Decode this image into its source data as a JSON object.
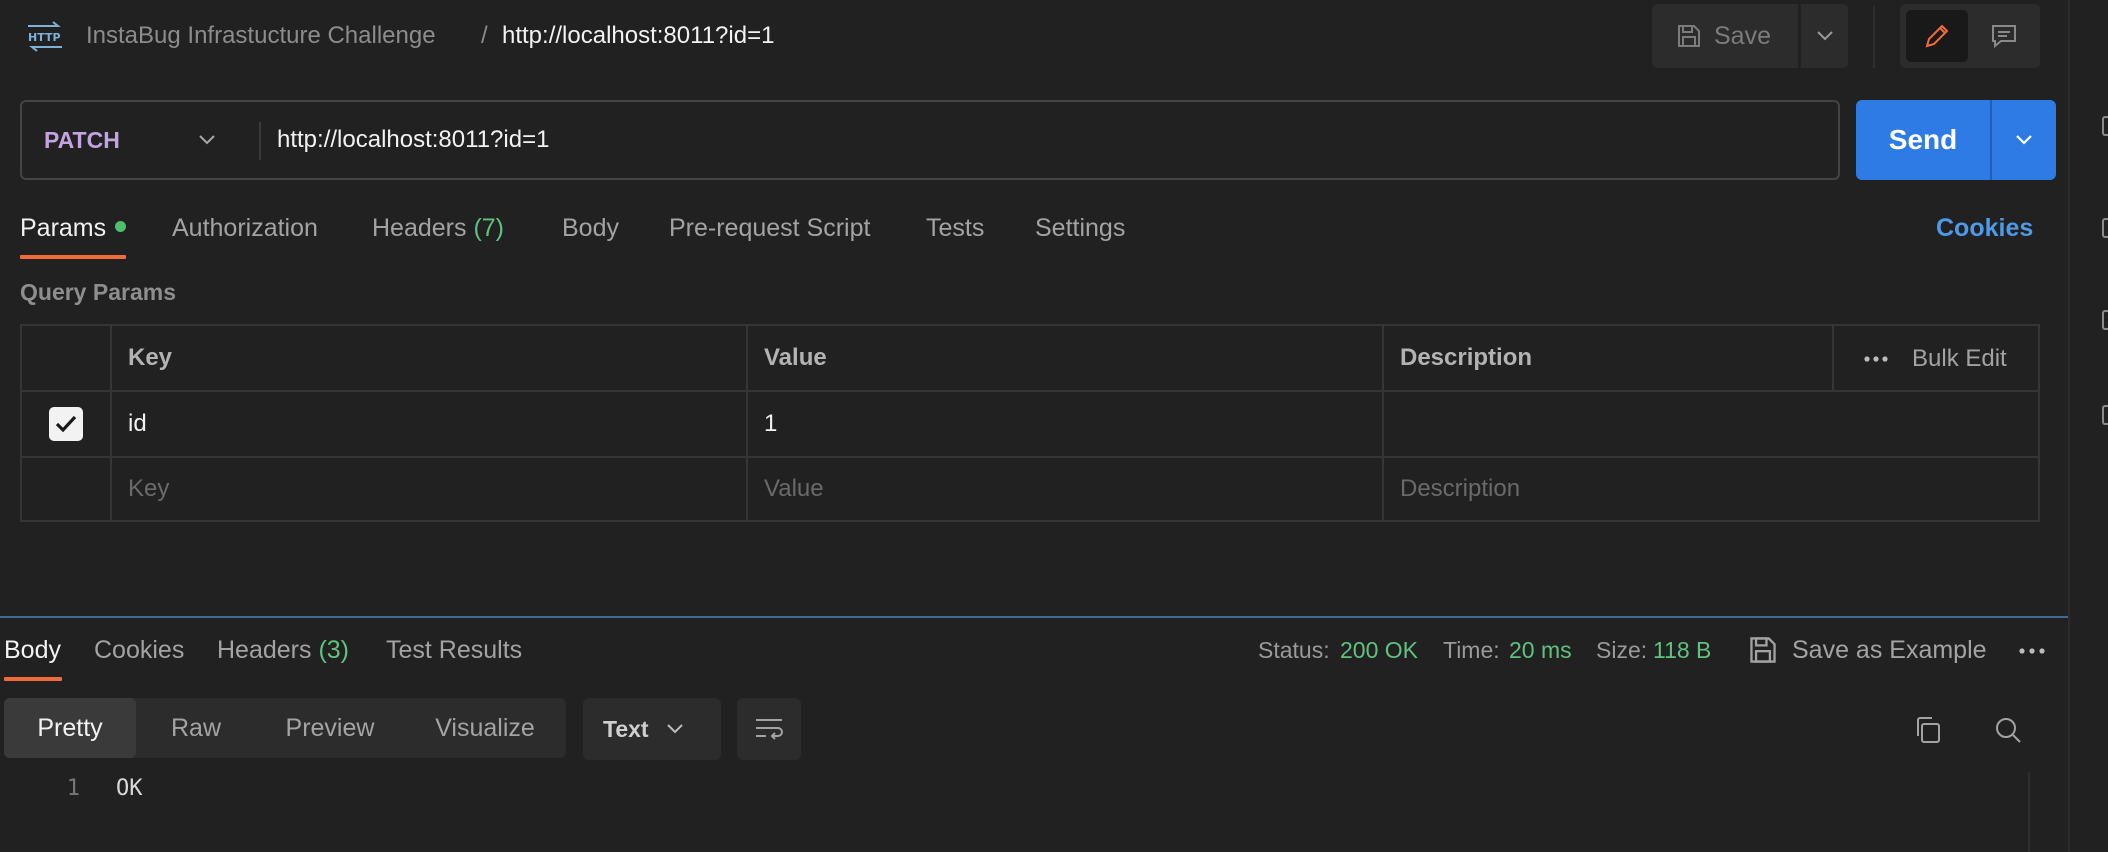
{
  "header": {
    "collection": "InstaBug Infrastucture Challenge",
    "separator": "/",
    "request_name": "http://localhost:8011?id=1",
    "save_label": "Save",
    "icons": {
      "app": "http-icon",
      "save": "save-icon",
      "edit": "pencil-icon",
      "comment": "comment-icon"
    }
  },
  "request": {
    "method": "PATCH",
    "url": "http://localhost:8011?id=1",
    "send_label": "Send",
    "method_color": "#c4a3e3"
  },
  "request_tabs": {
    "params": "Params",
    "authorization": "Authorization",
    "headers": "Headers",
    "headers_count": "(7)",
    "body": "Body",
    "prerequest": "Pre-request Script",
    "tests": "Tests",
    "settings": "Settings",
    "cookies": "Cookies",
    "active": "Params"
  },
  "query_params": {
    "title": "Query Params",
    "columns": {
      "key": "Key",
      "value": "Value",
      "description": "Description"
    },
    "bulk_edit": "Bulk Edit",
    "rows": [
      {
        "enabled": true,
        "key": "id",
        "value": "1",
        "description": ""
      }
    ],
    "placeholders": {
      "key": "Key",
      "value": "Value",
      "description": "Description"
    }
  },
  "response_tabs": {
    "body": "Body",
    "cookies": "Cookies",
    "headers": "Headers",
    "headers_count": "(3)",
    "test_results": "Test Results",
    "active": "Body"
  },
  "response_meta": {
    "status_label": "Status:",
    "status_value": "200 OK",
    "time_label": "Time:",
    "time_value": "20 ms",
    "size_label": "Size:",
    "size_value": "118 B",
    "save_example": "Save as Example"
  },
  "response_format": {
    "modes": [
      "Pretty",
      "Raw",
      "Preview",
      "Visualize"
    ],
    "active_mode": "Pretty",
    "language": "Text"
  },
  "response_body": {
    "lines": [
      {
        "number": "1",
        "text": "OK"
      }
    ]
  },
  "colors": {
    "accent": "#f26b3a",
    "send": "#2f7be6",
    "success": "#5fc27e",
    "link": "#4d9ae8",
    "background": "#212121"
  }
}
